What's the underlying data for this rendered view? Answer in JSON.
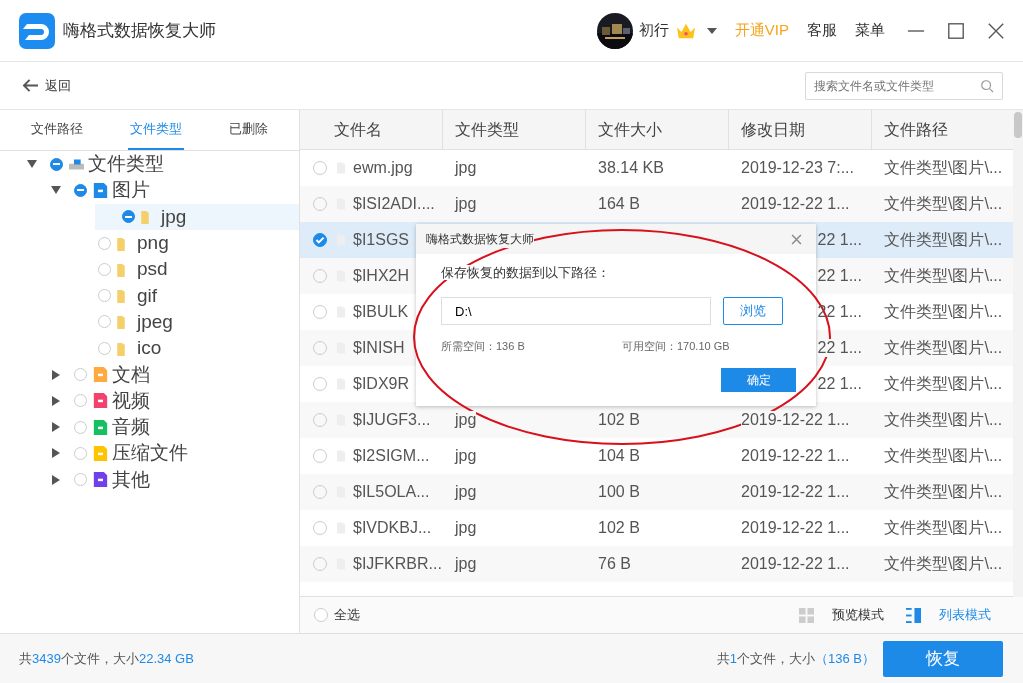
{
  "app": {
    "title": "嗨格式数据恢复大师",
    "user": "初行",
    "vip": "开通VIP",
    "service": "客服",
    "menu": "菜单"
  },
  "toolbar": {
    "back": "返回",
    "search": {
      "placeholder": "搜索文件名或文件类型"
    }
  },
  "tabs": [
    {
      "label": "文件路径",
      "selected": false
    },
    {
      "label": "文件类型",
      "selected": true
    },
    {
      "label": "已删除",
      "selected": false
    }
  ],
  "tree": [
    {
      "label": "文件类型",
      "kind": "drive",
      "checked": true,
      "expanded": true,
      "selected": false,
      "children": [
        {
          "label": "图片",
          "checked": true,
          "expanded": true,
          "selected": false,
          "children": [
            {
              "label": "jpg",
              "kind": "folder",
              "checked": true,
              "selected": true
            },
            {
              "label": "png",
              "kind": "folder",
              "checked": false,
              "selected": false
            },
            {
              "label": "psd",
              "kind": "folder",
              "checked": false,
              "selected": false
            },
            {
              "label": "gif",
              "kind": "folder",
              "checked": false,
              "selected": false
            },
            {
              "label": "jpeg",
              "kind": "folder",
              "checked": false,
              "selected": false
            },
            {
              "label": "ico",
              "kind": "folder",
              "checked": false,
              "selected": false
            }
          ]
        },
        {
          "label": "文档",
          "kind": "doc",
          "checked": false,
          "expanded": false,
          "selected": false
        },
        {
          "label": "视频",
          "kind": "video",
          "checked": false,
          "expanded": false,
          "selected": false
        },
        {
          "label": "音频",
          "kind": "audio",
          "checked": false,
          "expanded": false,
          "selected": false
        },
        {
          "label": "压缩文件",
          "kind": "zip",
          "checked": false,
          "expanded": false,
          "selected": false
        },
        {
          "label": "其他",
          "kind": "other",
          "checked": false,
          "expanded": false,
          "selected": false
        }
      ]
    }
  ],
  "table": {
    "columns": [
      "文件名",
      "文件类型",
      "文件大小",
      "修改日期",
      "文件路径"
    ],
    "rows": [
      {
        "name": "ewm.jpg",
        "type": "jpg",
        "size": "38.14 KB",
        "date": "2019-12-23 7:...",
        "path": "文件类型\\图片\\...",
        "checked": false
      },
      {
        "name": "$ISI2ADI....",
        "type": "jpg",
        "size": "164 B",
        "date": "2019-12-22 1...",
        "path": "文件类型\\图片\\...",
        "checked": false
      },
      {
        "name": "$I1SGS",
        "date_tail": "22 1...",
        "path": "文件类型\\图片\\...",
        "checked": true
      },
      {
        "name": "$IHX2H",
        "date_tail": "22 1...",
        "path": "文件类型\\图片\\...",
        "checked": false
      },
      {
        "name": "$IBULK",
        "date_tail": "22 1...",
        "path": "文件类型\\图片\\...",
        "checked": false
      },
      {
        "name": "$INISH",
        "date_tail": "22 1...",
        "path": "文件类型\\图片\\...",
        "checked": false
      },
      {
        "name": "$IDX9R",
        "date_tail": "22 1...",
        "path": "文件类型\\图片\\...",
        "checked": false
      },
      {
        "name": "$IJUGF3...",
        "type": "jpg",
        "size": "102 B",
        "date": "2019-12-22 1...",
        "path": "文件类型\\图片\\...",
        "checked": false
      },
      {
        "name": "$I2SIGM...",
        "type": "jpg",
        "size": "104 B",
        "date": "2019-12-22 1...",
        "path": "文件类型\\图片\\...",
        "checked": false
      },
      {
        "name": "$IL5OLA...",
        "type": "jpg",
        "size": "100 B",
        "date": "2019-12-22 1...",
        "path": "文件类型\\图片\\...",
        "checked": false
      },
      {
        "name": "$IVDKBJ...",
        "type": "jpg",
        "size": "102 B",
        "date": "2019-12-22 1...",
        "path": "文件类型\\图片\\...",
        "checked": false
      },
      {
        "name": "$IJFKRBR...",
        "type": "jpg",
        "size": "76 B",
        "date": "2019-12-22 1...",
        "path": "文件类型\\图片\\...",
        "checked": false
      }
    ]
  },
  "list_footer": {
    "select_all": {
      "label": "全选",
      "checked": false
    },
    "views": [
      {
        "kind": "grid",
        "label": "预览模式",
        "selected": false
      },
      {
        "kind": "list",
        "label": "列表模式",
        "selected": true
      }
    ]
  },
  "status": {
    "left": [
      {
        "text": "共",
        "highlight": false
      },
      {
        "text": "3439",
        "highlight": true
      },
      {
        "text": "个文件，大小",
        "highlight": false
      },
      {
        "text": "22.34 GB",
        "highlight": true
      }
    ],
    "right": [
      {
        "text": "共",
        "highlight": false
      },
      {
        "text": "1",
        "highlight": true
      },
      {
        "text": "个文件，大小",
        "highlight": false
      },
      {
        "text": "（136 B）",
        "highlight": true
      }
    ],
    "recover": "恢复"
  },
  "dialog": {
    "title": "嗨格式数据恢复大师",
    "prompt": "保存恢复的数据到以下路径：",
    "path": "D:\\",
    "browse": "浏览",
    "required": "所需空间：136 B",
    "available": "可用空间：170.10 GB",
    "confirm": "确定"
  }
}
